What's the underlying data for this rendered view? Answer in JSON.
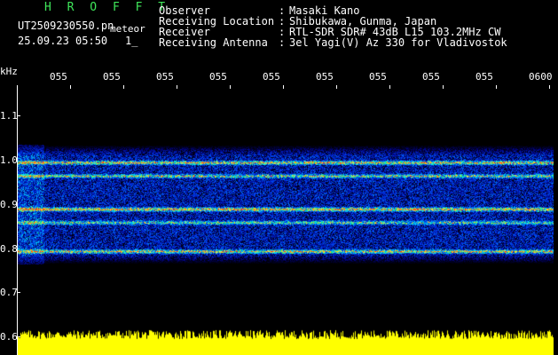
{
  "header": {
    "brand": "H R O F F T",
    "filename": "UT2509230550.pn",
    "filename_suffix": "meteor",
    "datetime": "25.09.23 05:50",
    "counter": "1_",
    "labels": [
      "Observer",
      "Receiving Location",
      "Receiver",
      "Receiving Antenna"
    ],
    "separators": [
      ":",
      ":",
      ":",
      ":"
    ],
    "values": [
      "Masaki Kano",
      "Shibukawa, Gunma, Japan",
      "RTL-SDR SDR# 43dB L15 103.2MHz CW",
      "3el Yagi(V) Az 330 for Vladivostok"
    ]
  },
  "axes": {
    "y_unit": "kHz",
    "y_ticks": [
      "1.1",
      "1.0",
      "0.9",
      "0.8",
      "0.7",
      "0.6"
    ],
    "x_ticks": [
      "055",
      "055",
      "055",
      "055",
      "055",
      "055",
      "055",
      "055",
      "055",
      "0600"
    ]
  },
  "colors": {
    "background": "#000000",
    "brand": "#3fe65a",
    "text": "#ffffff",
    "power_trace": "#ffff00",
    "signal_low": "#1020c0",
    "signal_mid": "#30c0ff",
    "signal_high": "#ff3010"
  },
  "chart_data": {
    "type": "heatmap",
    "ylabel": "kHz",
    "ylim": [
      0.6,
      1.15
    ],
    "signal_bands_khz": [
      0.99,
      0.96,
      0.885,
      0.855,
      0.79
    ],
    "band_intensity": [
      0.85,
      0.7,
      0.95,
      0.65,
      0.8
    ]
  }
}
